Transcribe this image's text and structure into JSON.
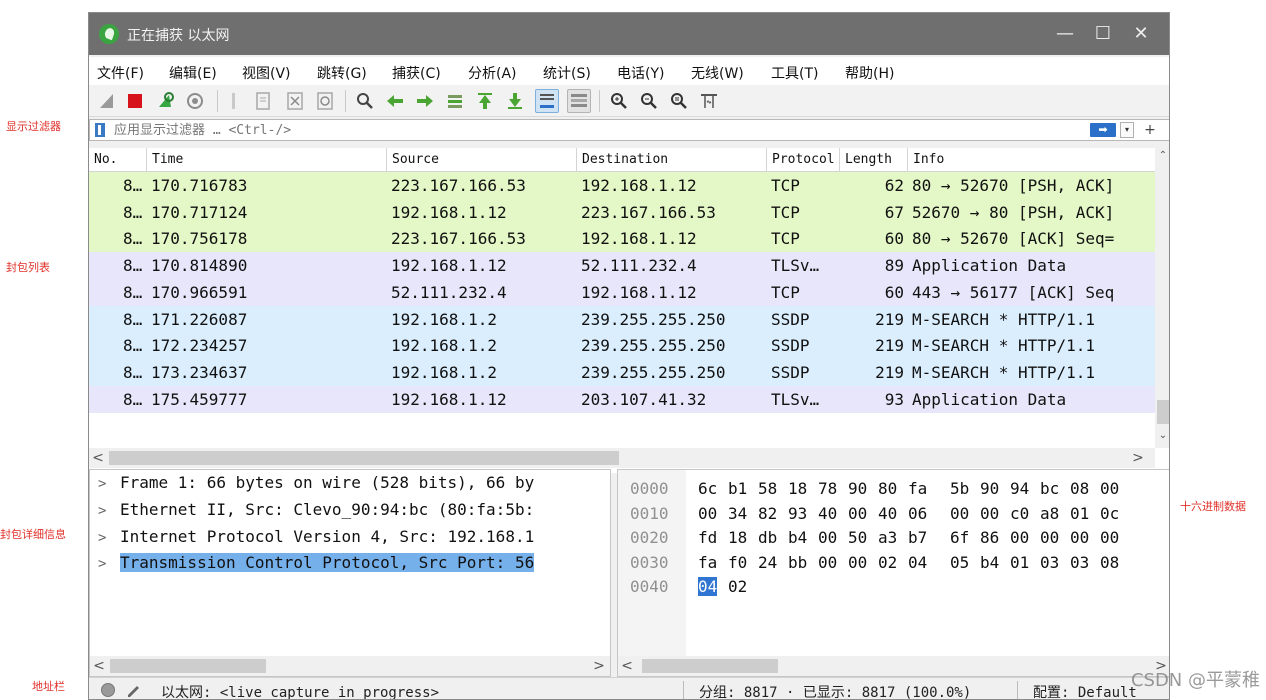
{
  "annotations": {
    "display_filter": "显示过滤器",
    "packet_list": "封包列表",
    "packet_details": "封包详细信息",
    "hex_data": "十六进制数据",
    "address_bar": "地址栏"
  },
  "window": {
    "title": "正在捕获 以太网",
    "minimize": "—",
    "maximize": "☐",
    "close": "✕"
  },
  "menu": [
    "文件(F)",
    "编辑(E)",
    "视图(V)",
    "跳转(G)",
    "捕获(C)",
    "分析(A)",
    "统计(S)",
    "电话(Y)",
    "无线(W)",
    "工具(T)",
    "帮助(H)"
  ],
  "toolbar_icons": [
    "shark-fin-icon",
    "stop-icon",
    "restart-icon",
    "options-icon",
    "open-icon",
    "save-icon",
    "close-file-icon",
    "reload-icon",
    "find-icon",
    "back-icon",
    "forward-icon",
    "goto-icon",
    "first-icon",
    "last-icon",
    "autoscroll-icon",
    "colorize-icon",
    "zoom-in-icon",
    "zoom-out-icon",
    "normal-size-icon",
    "resize-columns-icon"
  ],
  "filter": {
    "placeholder": "应用显示过滤器 … <Ctrl-/>",
    "apply": "➡",
    "dropdown": "▾",
    "add": "+"
  },
  "columns": [
    "No.",
    "Time",
    "Source",
    "Destination",
    "Protocol",
    "Length",
    "Info"
  ],
  "packets": [
    {
      "no": "8…",
      "time": "170.716783",
      "source": "223.167.166.53",
      "destination": "192.168.1.12",
      "protocol": "TCP",
      "length": "62",
      "info": "80 → 52670 [PSH, ACK]",
      "color": "#e4f7c6"
    },
    {
      "no": "8…",
      "time": "170.717124",
      "source": "192.168.1.12",
      "destination": "223.167.166.53",
      "protocol": "TCP",
      "length": "67",
      "info": "52670 → 80 [PSH, ACK]",
      "color": "#e4f7c6"
    },
    {
      "no": "8…",
      "time": "170.756178",
      "source": "223.167.166.53",
      "destination": "192.168.1.12",
      "protocol": "TCP",
      "length": "60",
      "info": "80 → 52670 [ACK] Seq=",
      "color": "#e4f7c6"
    },
    {
      "no": "8…",
      "time": "170.814890",
      "source": "192.168.1.12",
      "destination": "52.111.232.4",
      "protocol": "TLSv…",
      "length": "89",
      "info": "Application Data",
      "color": "#e7e6fa"
    },
    {
      "no": "8…",
      "time": "170.966591",
      "source": "52.111.232.4",
      "destination": "192.168.1.12",
      "protocol": "TCP",
      "length": "60",
      "info": "443 → 56177 [ACK] Seq",
      "color": "#e7e6fa"
    },
    {
      "no": "8…",
      "time": "171.226087",
      "source": "192.168.1.2",
      "destination": "239.255.255.250",
      "protocol": "SSDP",
      "length": "219",
      "info": "M-SEARCH * HTTP/1.1",
      "color": "#daeefe"
    },
    {
      "no": "8…",
      "time": "172.234257",
      "source": "192.168.1.2",
      "destination": "239.255.255.250",
      "protocol": "SSDP",
      "length": "219",
      "info": "M-SEARCH * HTTP/1.1",
      "color": "#daeefe"
    },
    {
      "no": "8…",
      "time": "173.234637",
      "source": "192.168.1.2",
      "destination": "239.255.255.250",
      "protocol": "SSDP",
      "length": "219",
      "info": "M-SEARCH * HTTP/1.1",
      "color": "#daeefe"
    },
    {
      "no": "8…",
      "time": "175.459777",
      "source": "192.168.1.12",
      "destination": "203.107.41.32",
      "protocol": "TLSv…",
      "length": "93",
      "info": "Application Data",
      "color": "#e7e6fa"
    }
  ],
  "details": [
    {
      "caret": ">",
      "text": "Frame 1: 66 bytes on wire (528 bits), 66 by"
    },
    {
      "caret": ">",
      "text": "Ethernet II, Src: Clevo_90:94:bc (80:fa:5b:"
    },
    {
      "caret": ">",
      "text": "Internet Protocol Version 4, Src: 192.168.1"
    },
    {
      "caret": ">",
      "text": "Transmission Control Protocol, Src Port: 56"
    }
  ],
  "hex_rows": [
    {
      "offset": "0000",
      "bytes": [
        "6c",
        "b1",
        "58",
        "18",
        "78",
        "90",
        "80",
        "fa",
        "5b",
        "90",
        "94",
        "bc",
        "08",
        "00"
      ]
    },
    {
      "offset": "0010",
      "bytes": [
        "00",
        "34",
        "82",
        "93",
        "40",
        "00",
        "40",
        "06",
        "00",
        "00",
        "c0",
        "a8",
        "01",
        "0c"
      ]
    },
    {
      "offset": "0020",
      "bytes": [
        "fd",
        "18",
        "db",
        "b4",
        "00",
        "50",
        "a3",
        "b7",
        "6f",
        "86",
        "00",
        "00",
        "00",
        "00"
      ]
    },
    {
      "offset": "0030",
      "bytes": [
        "fa",
        "f0",
        "24",
        "bb",
        "00",
        "00",
        "02",
        "04",
        "05",
        "b4",
        "01",
        "03",
        "03",
        "08"
      ]
    },
    {
      "offset": "0040",
      "bytes": [
        "04",
        "02"
      ]
    }
  ],
  "status": {
    "interface": "以太网: <live capture in progress>",
    "packets": "分组: 8817 · 已显示: 8817 (100.0%)",
    "profile": "配置: Default"
  },
  "watermark": "CSDN @平蒙稚",
  "scroll": {
    "up": "⌃",
    "down": "⌄",
    "left": "<",
    "right": ">"
  }
}
